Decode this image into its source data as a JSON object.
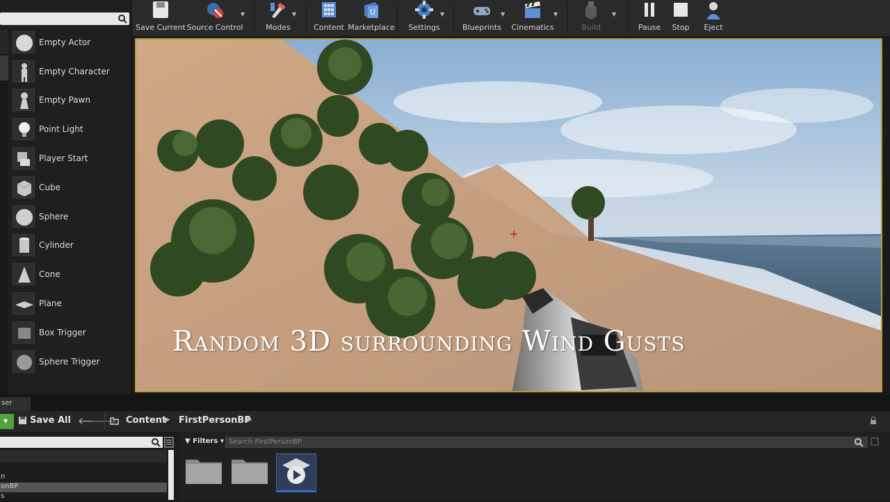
{
  "toolbar": {
    "buttons": [
      {
        "label": "Save Current",
        "icon": "save-icon"
      },
      {
        "label": "Source Control",
        "icon": "source-control-icon"
      },
      {
        "label": "Modes",
        "icon": "modes-icon"
      },
      {
        "label": "Content",
        "icon": "content-icon"
      },
      {
        "label": "Marketplace",
        "icon": "marketplace-icon"
      },
      {
        "label": "Settings",
        "icon": "settings-icon"
      },
      {
        "label": "Blueprints",
        "icon": "blueprints-icon"
      },
      {
        "label": "Cinematics",
        "icon": "cinematics-icon"
      },
      {
        "label": "Build",
        "icon": "build-icon"
      },
      {
        "label": "Pause",
        "icon": "pause-icon"
      },
      {
        "label": "Stop",
        "icon": "stop-icon"
      },
      {
        "label": "Eject",
        "icon": "eject-icon"
      }
    ]
  },
  "place_panel": {
    "items": [
      {
        "label": "Empty Actor",
        "icon": "sphere-icon"
      },
      {
        "label": "Empty Character",
        "icon": "character-icon"
      },
      {
        "label": "Empty Pawn",
        "icon": "pawn-icon"
      },
      {
        "label": "Point Light",
        "icon": "light-bulb-icon"
      },
      {
        "label": "Player Start",
        "icon": "player-start-icon"
      },
      {
        "label": "Cube",
        "icon": "cube-icon"
      },
      {
        "label": "Sphere",
        "icon": "sphere-icon"
      },
      {
        "label": "Cylinder",
        "icon": "cylinder-icon"
      },
      {
        "label": "Cone",
        "icon": "cone-icon"
      },
      {
        "label": "Plane",
        "icon": "plane-icon"
      },
      {
        "label": "Box Trigger",
        "icon": "box-trigger-icon"
      },
      {
        "label": "Sphere Trigger",
        "icon": "sphere-trigger-icon"
      }
    ]
  },
  "viewport": {
    "caption": "Random 3D surrounding Wind Gusts"
  },
  "content_browser": {
    "tab_label": "ser",
    "save_all": "Save All",
    "breadcrumb": [
      "Content",
      "FirstPersonBP"
    ],
    "filters_label": "Filters",
    "search_placeholder": "Search FirstPersonBP",
    "tree_rows": [
      "n",
      "onBP",
      "s"
    ]
  },
  "colors": {
    "viewport_border": "#b39b3e",
    "add_button": "#4fa33a",
    "panel_bg": "#1f1f1f"
  }
}
